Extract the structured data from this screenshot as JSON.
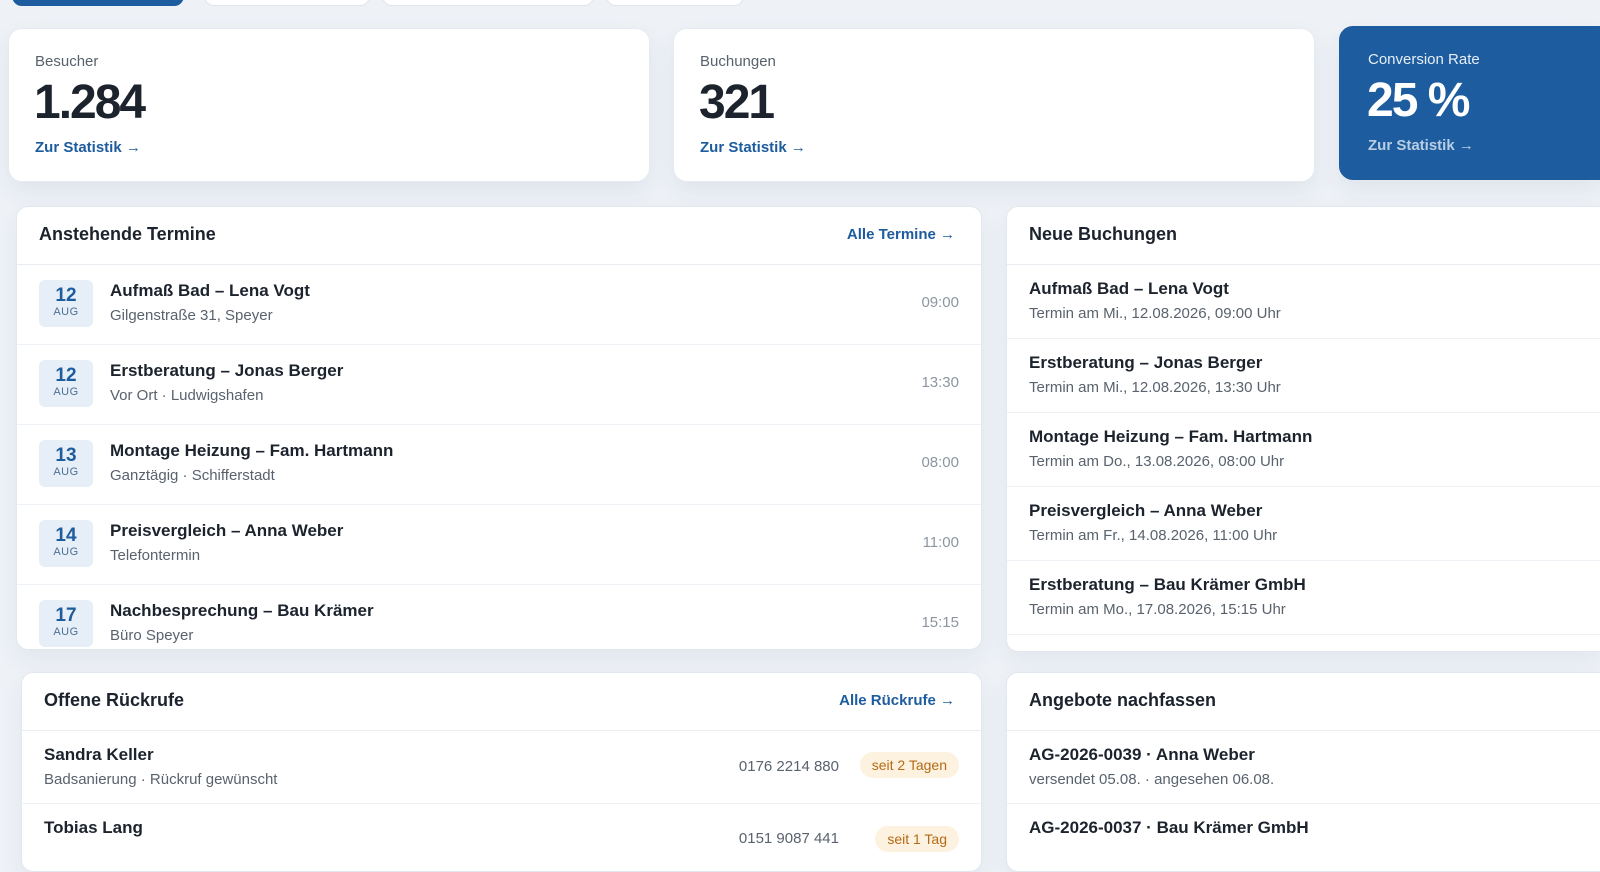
{
  "stats": [
    {
      "label": "Besucher",
      "value": "1.284",
      "link": "Zur Statistik →"
    },
    {
      "label": "Buchungen",
      "value": "321",
      "link": "Zur Statistik →"
    },
    {
      "label": "Conversion Rate",
      "value": "25 %",
      "link": "Zur Statistik →"
    }
  ],
  "termine": {
    "title": "Anstehende Termine",
    "link": "Alle Termine →",
    "rows": [
      {
        "day": "12",
        "month": "AUG",
        "title": "Aufmaß Bad – Lena Vogt",
        "sub": "Gilgenstraße 31, Speyer",
        "time": "09:00"
      },
      {
        "day": "12",
        "month": "AUG",
        "title": "Erstberatung – Jonas Berger",
        "sub": "Vor Ort · Ludwigshafen",
        "time": "13:30"
      },
      {
        "day": "13",
        "month": "AUG",
        "title": "Montage Heizung – Fam. Hartmann",
        "sub": "Ganztägig · Schifferstadt",
        "time": "08:00"
      },
      {
        "day": "14",
        "month": "AUG",
        "title": "Preisvergleich – Anna Weber",
        "sub": "Telefontermin",
        "time": "11:00"
      },
      {
        "day": "17",
        "month": "AUG",
        "title": "Nachbesprechung – Bau Krämer",
        "sub": "Büro Speyer",
        "time": "15:15"
      }
    ]
  },
  "buchungen": {
    "title": "Neue Buchungen",
    "rows": [
      {
        "title": "Aufmaß Bad – Lena Vogt",
        "sub": "Termin am Mi., 12.08.2026, 09:00 Uhr"
      },
      {
        "title": "Erstberatung – Jonas Berger",
        "sub": "Termin am Mi., 12.08.2026, 13:30 Uhr"
      },
      {
        "title": "Montage Heizung – Fam. Hartmann",
        "sub": "Termin am Do., 13.08.2026, 08:00 Uhr"
      },
      {
        "title": "Preisvergleich – Anna Weber",
        "sub": "Termin am Fr., 14.08.2026, 11:00 Uhr"
      },
      {
        "title": "Erstberatung – Bau Krämer GmbH",
        "sub": "Termin am Mo., 17.08.2026, 15:15 Uhr"
      }
    ]
  },
  "rueckrufe": {
    "title": "Offene Rückrufe",
    "link": "Alle Rückrufe →",
    "rows": [
      {
        "name": "Sandra Keller",
        "sub": "Badsanierung · Rückruf gewünscht",
        "phone": "0176 2214 880",
        "badge": "seit 2 Tagen"
      },
      {
        "name": "Tobias Lang",
        "sub": "",
        "phone": "0151 9087 441",
        "badge": "seit 1 Tag"
      }
    ]
  },
  "angebote": {
    "title": "Angebote nachfassen",
    "rows": [
      {
        "title": "AG-2026-0039 · Anna Weber",
        "sub": "versendet 05.08. · angesehen 06.08."
      },
      {
        "title": "AG-2026-0037 · Bau Krämer GmbH",
        "sub": ""
      }
    ]
  },
  "colors": {
    "accent": "#1d5c9e",
    "badge_bg": "#fdf1e0",
    "badge_text": "#b46a16"
  }
}
